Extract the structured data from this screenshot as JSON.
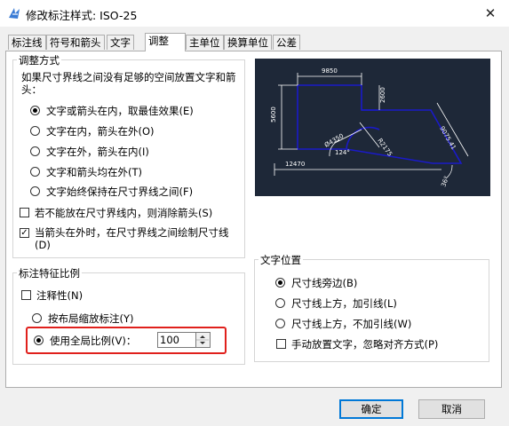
{
  "window": {
    "title": "修改标注样式: ISO-25",
    "close_glyph": "✕"
  },
  "tabs": [
    {
      "label": "标注线"
    },
    {
      "label": "符号和箭头"
    },
    {
      "label": "文字"
    },
    {
      "label": "调整"
    },
    {
      "label": "主单位"
    },
    {
      "label": "换算单位"
    },
    {
      "label": "公差"
    }
  ],
  "active_tab": "调整",
  "fit_group": {
    "title": "调整方式",
    "description": "如果尺寸界线之间没有足够的空间放置文字和箭头：",
    "options": [
      {
        "label": "文字或箭头在内，取最佳效果(E)",
        "selected": true
      },
      {
        "label": "文字在内，箭头在外(O)",
        "selected": false
      },
      {
        "label": "文字在外，箭头在内(I)",
        "selected": false
      },
      {
        "label": "文字和箭头均在外(T)",
        "selected": false
      },
      {
        "label": "文字始终保持在尺寸界线之间(F)",
        "selected": false
      }
    ],
    "suppress_arrows": {
      "label": "若不能放在尺寸界线内，则消除箭头(S)",
      "checked": false
    },
    "draw_line": {
      "label": "当箭头在外时，在尺寸界线之间绘制尺寸线(D)",
      "checked": true
    }
  },
  "preview": {
    "labels": [
      "9850",
      "5600",
      "2600",
      "9075.41",
      "R2175",
      "Ø4350",
      "124°",
      "12470",
      "36°"
    ]
  },
  "scale_group": {
    "title": "标注特征比例",
    "annotative": {
      "label": "注释性(N)",
      "checked": false
    },
    "layout_scale": {
      "label": "按布局缩放标注(Y)",
      "selected": false
    },
    "global_scale": {
      "label": "使用全局比例(V)：",
      "selected": true,
      "value": "100"
    }
  },
  "text_group": {
    "title": "文字位置",
    "options": [
      {
        "label": "尺寸线旁边(B)",
        "selected": true
      },
      {
        "label": "尺寸线上方，加引线(L)",
        "selected": false
      },
      {
        "label": "尺寸线上方，不加引线(W)",
        "selected": false
      }
    ],
    "manual": {
      "label": "手动放置文字，忽略对齐方式(P)",
      "checked": false
    }
  },
  "buttons": {
    "ok": "确定",
    "cancel": "取消"
  },
  "colors": {
    "highlight": "#e0201c",
    "preview_bg": "#1e2838",
    "preview_lines": "#1a1ac8"
  }
}
